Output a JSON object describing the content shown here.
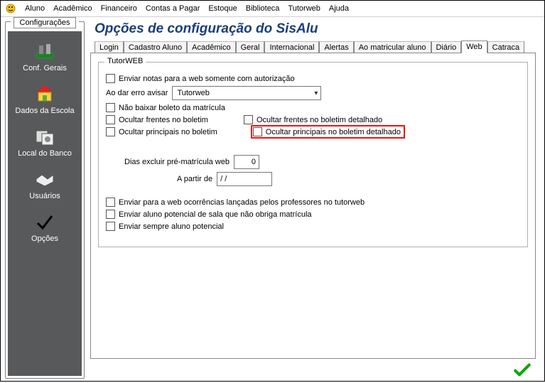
{
  "menu": {
    "items": [
      "Aluno",
      "Acadêmico",
      "Financeiro",
      "Contas a Pagar",
      "Estoque",
      "Biblioteca",
      "Tutorweb",
      "Ajuda"
    ]
  },
  "sidebar": {
    "title": "Configurações",
    "items": [
      {
        "label": "Conf. Gerais",
        "icon": "tools-icon"
      },
      {
        "label": "Dados da Escola",
        "icon": "school-icon"
      },
      {
        "label": "Local do Banco",
        "icon": "disks-icon"
      },
      {
        "label": "Usuários",
        "icon": "handshake-icon"
      },
      {
        "label": "Opções",
        "icon": "check-icon"
      }
    ]
  },
  "page": {
    "title": "Opções de configuração do SisAlu"
  },
  "tabs": {
    "items": [
      "Login",
      "Cadastro Aluno",
      "Acadêmico",
      "Geral",
      "Internacional",
      "Alertas",
      "Ao matricular aluno",
      "Diário",
      "Web",
      "Catraca"
    ],
    "active": "Web"
  },
  "group": {
    "title": "TutorWEB",
    "enviar_notas_autorizacao": "Enviar notas para a web somente com autorização",
    "ao_erro_label": "Ao dar erro avisar",
    "ao_erro_value": "Tutorweb",
    "nao_baixar_boleto": "Não baixar boleto da matrícula",
    "ocultar_frentes_boletim": "Ocultar frentes no boletim",
    "ocultar_frentes_boletim_det": "Ocultar frentes no boletim detalhado",
    "ocultar_principais_boletim": "Ocultar principais no boletim",
    "ocultar_principais_boletim_det": "Ocultar principais no boletim detalhado",
    "dias_excluir_label": "Dias excluir pré-matrícula web",
    "dias_excluir_value": "0",
    "a_partir_label": "A partir de",
    "a_partir_value": "  /  /",
    "enviar_ocorrencias": "Enviar para a web ocorrências lançadas pelos professores no tutorweb",
    "enviar_aluno_potencial_sala": "Enviar aluno potencial de sala que não obriga matrícula",
    "enviar_sempre_potencial": "Enviar sempre aluno potencial"
  }
}
